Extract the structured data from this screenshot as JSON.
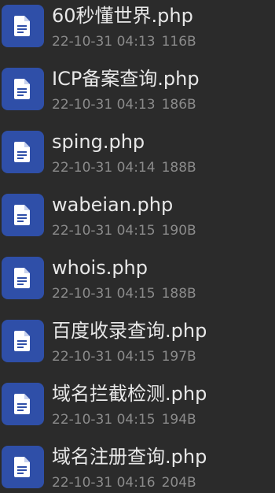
{
  "files": [
    {
      "name": "60秒懂世界.php",
      "date": "22-10-31 04:13",
      "size": "116B",
      "icon": "document-icon"
    },
    {
      "name": "ICP备案查询.php",
      "date": "22-10-31 04:13",
      "size": "186B",
      "icon": "document-icon"
    },
    {
      "name": "sping.php",
      "date": "22-10-31 04:14",
      "size": "188B",
      "icon": "document-icon"
    },
    {
      "name": "wabeian.php",
      "date": "22-10-31 04:15",
      "size": "190B",
      "icon": "document-icon"
    },
    {
      "name": "whois.php",
      "date": "22-10-31 04:15",
      "size": "188B",
      "icon": "document-icon"
    },
    {
      "name": "百度收录查询.php",
      "date": "22-10-31 04:15",
      "size": "197B",
      "icon": "document-icon"
    },
    {
      "name": "域名拦截检测.php",
      "date": "22-10-31 04:15",
      "size": "194B",
      "icon": "document-icon"
    },
    {
      "name": "域名注册查询.php",
      "date": "22-10-31 04:16",
      "size": "204B",
      "icon": "document-icon"
    }
  ],
  "colors": {
    "background": "#2b2b2b",
    "icon_bg": "#2f4fa8",
    "icon_fg": "#ffffff",
    "name_text": "#e8e8e8",
    "meta_text": "#8b8b8b"
  }
}
